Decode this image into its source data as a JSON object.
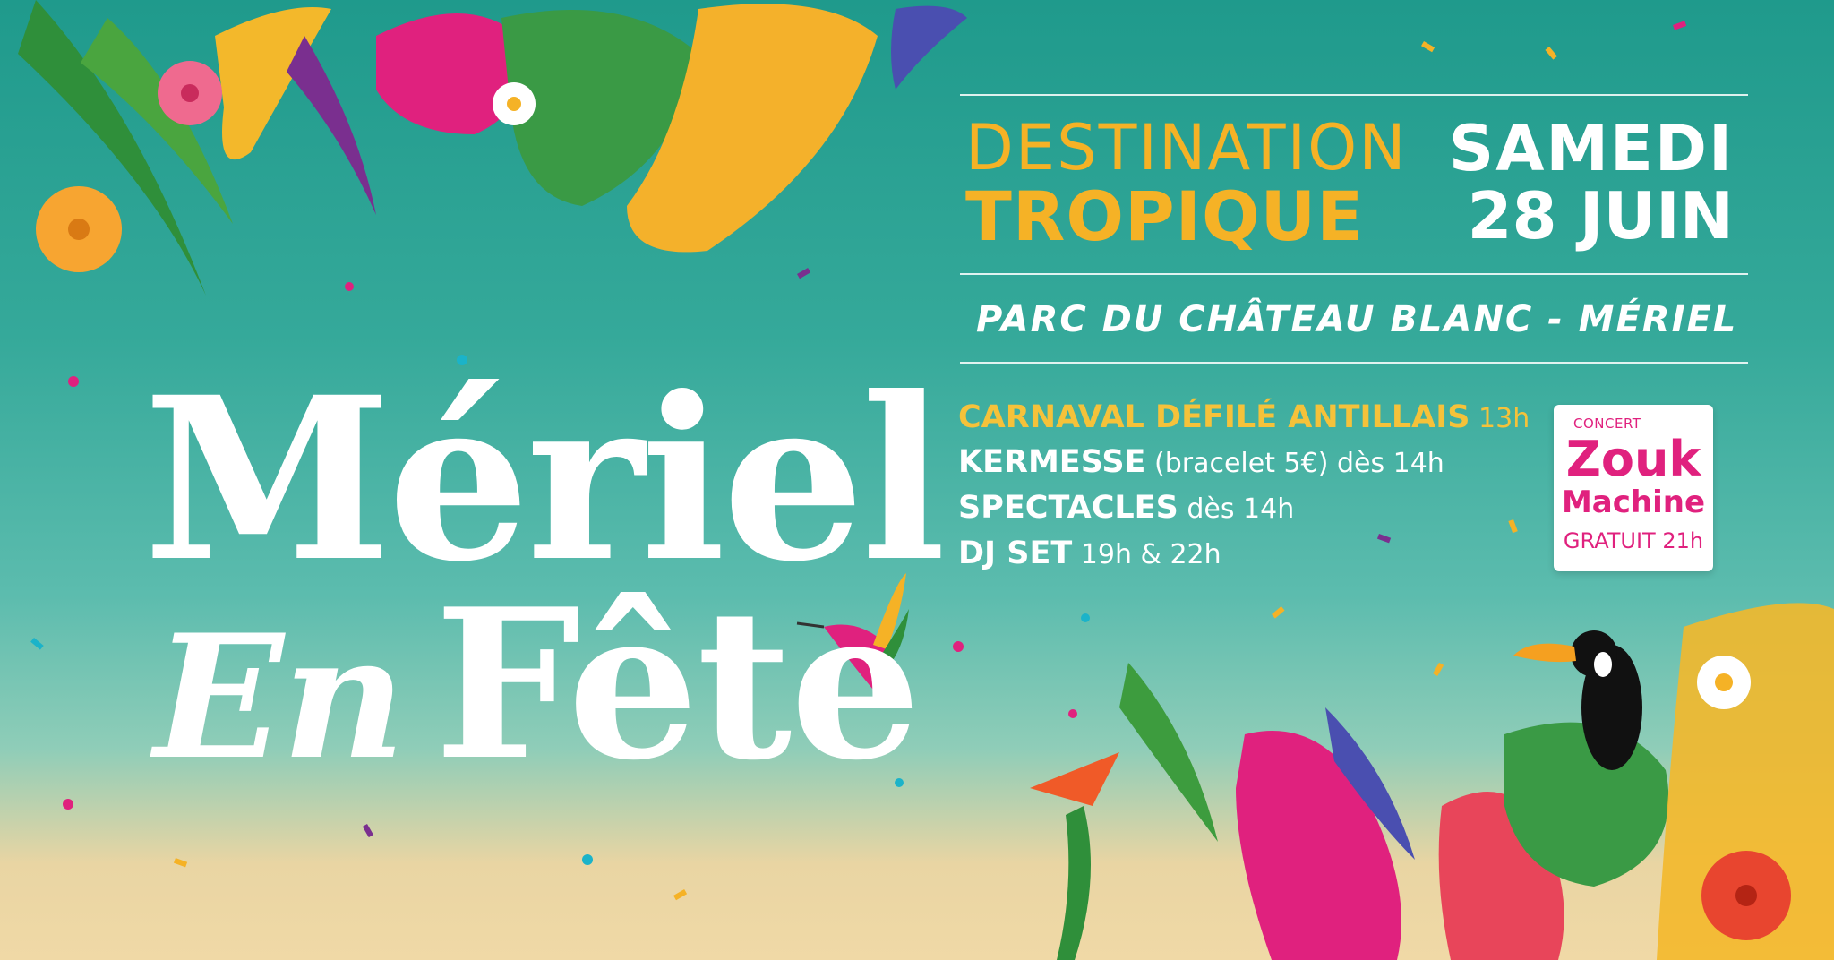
{
  "title": {
    "line1": "Mériel",
    "line2_en": "En",
    "line2_fete": "Fête"
  },
  "theme": {
    "line1": "DESTINATION",
    "line2": "TROPIQUE"
  },
  "date": {
    "line1": "SAMEDI",
    "line2": "28 JUIN"
  },
  "venue": "PARC DU CHÂTEAU BLANC - MÉRIEL",
  "program": [
    {
      "label": "CARNAVAL DÉFILÉ ANTILLAIS",
      "detail": " 13h"
    },
    {
      "label": "KERMESSE",
      "detail": " (bracelet 5€) dès 14h"
    },
    {
      "label": "SPECTACLES",
      "detail": " dès 14h"
    },
    {
      "label": "DJ SET",
      "detail": " 19h & 22h"
    }
  ],
  "concert": {
    "kicker": "CONCERT",
    "name1": "Zouk",
    "name2": "Machine",
    "info": "GRATUIT 21h"
  },
  "colors": {
    "teal": "#1f9a8c",
    "gold": "#f5b226",
    "pink": "#e0217e",
    "white": "#ffffff",
    "sand": "#f0d9a6"
  }
}
